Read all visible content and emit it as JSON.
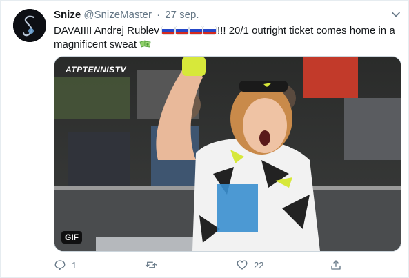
{
  "tweet": {
    "author_name": "Snize",
    "author_handle": "@SnizeMaster",
    "separator": "·",
    "date": "27 sep.",
    "text_before_flags": "DAVAIIII Andrej Rublev ",
    "text_after_flags": "!!! 20/1 outright ticket comes home in a magnificent sweat ",
    "flags": [
      "russia-flag-icon",
      "russia-flag-icon",
      "russia-flag-icon",
      "russia-flag-icon"
    ],
    "trailing_emoji": "money-with-wings-icon"
  },
  "media": {
    "watermark": "ATPTENNISTV",
    "badge": "GIF"
  },
  "actions": {
    "reply_count": "1",
    "retweet_count": "",
    "like_count": "22",
    "share_count": ""
  },
  "colors": {
    "secondary_text": "#657786",
    "border": "#e6ecf0",
    "flag_white": "#ffffff",
    "flag_blue": "#2547c7",
    "flag_red": "#d52b1e"
  }
}
